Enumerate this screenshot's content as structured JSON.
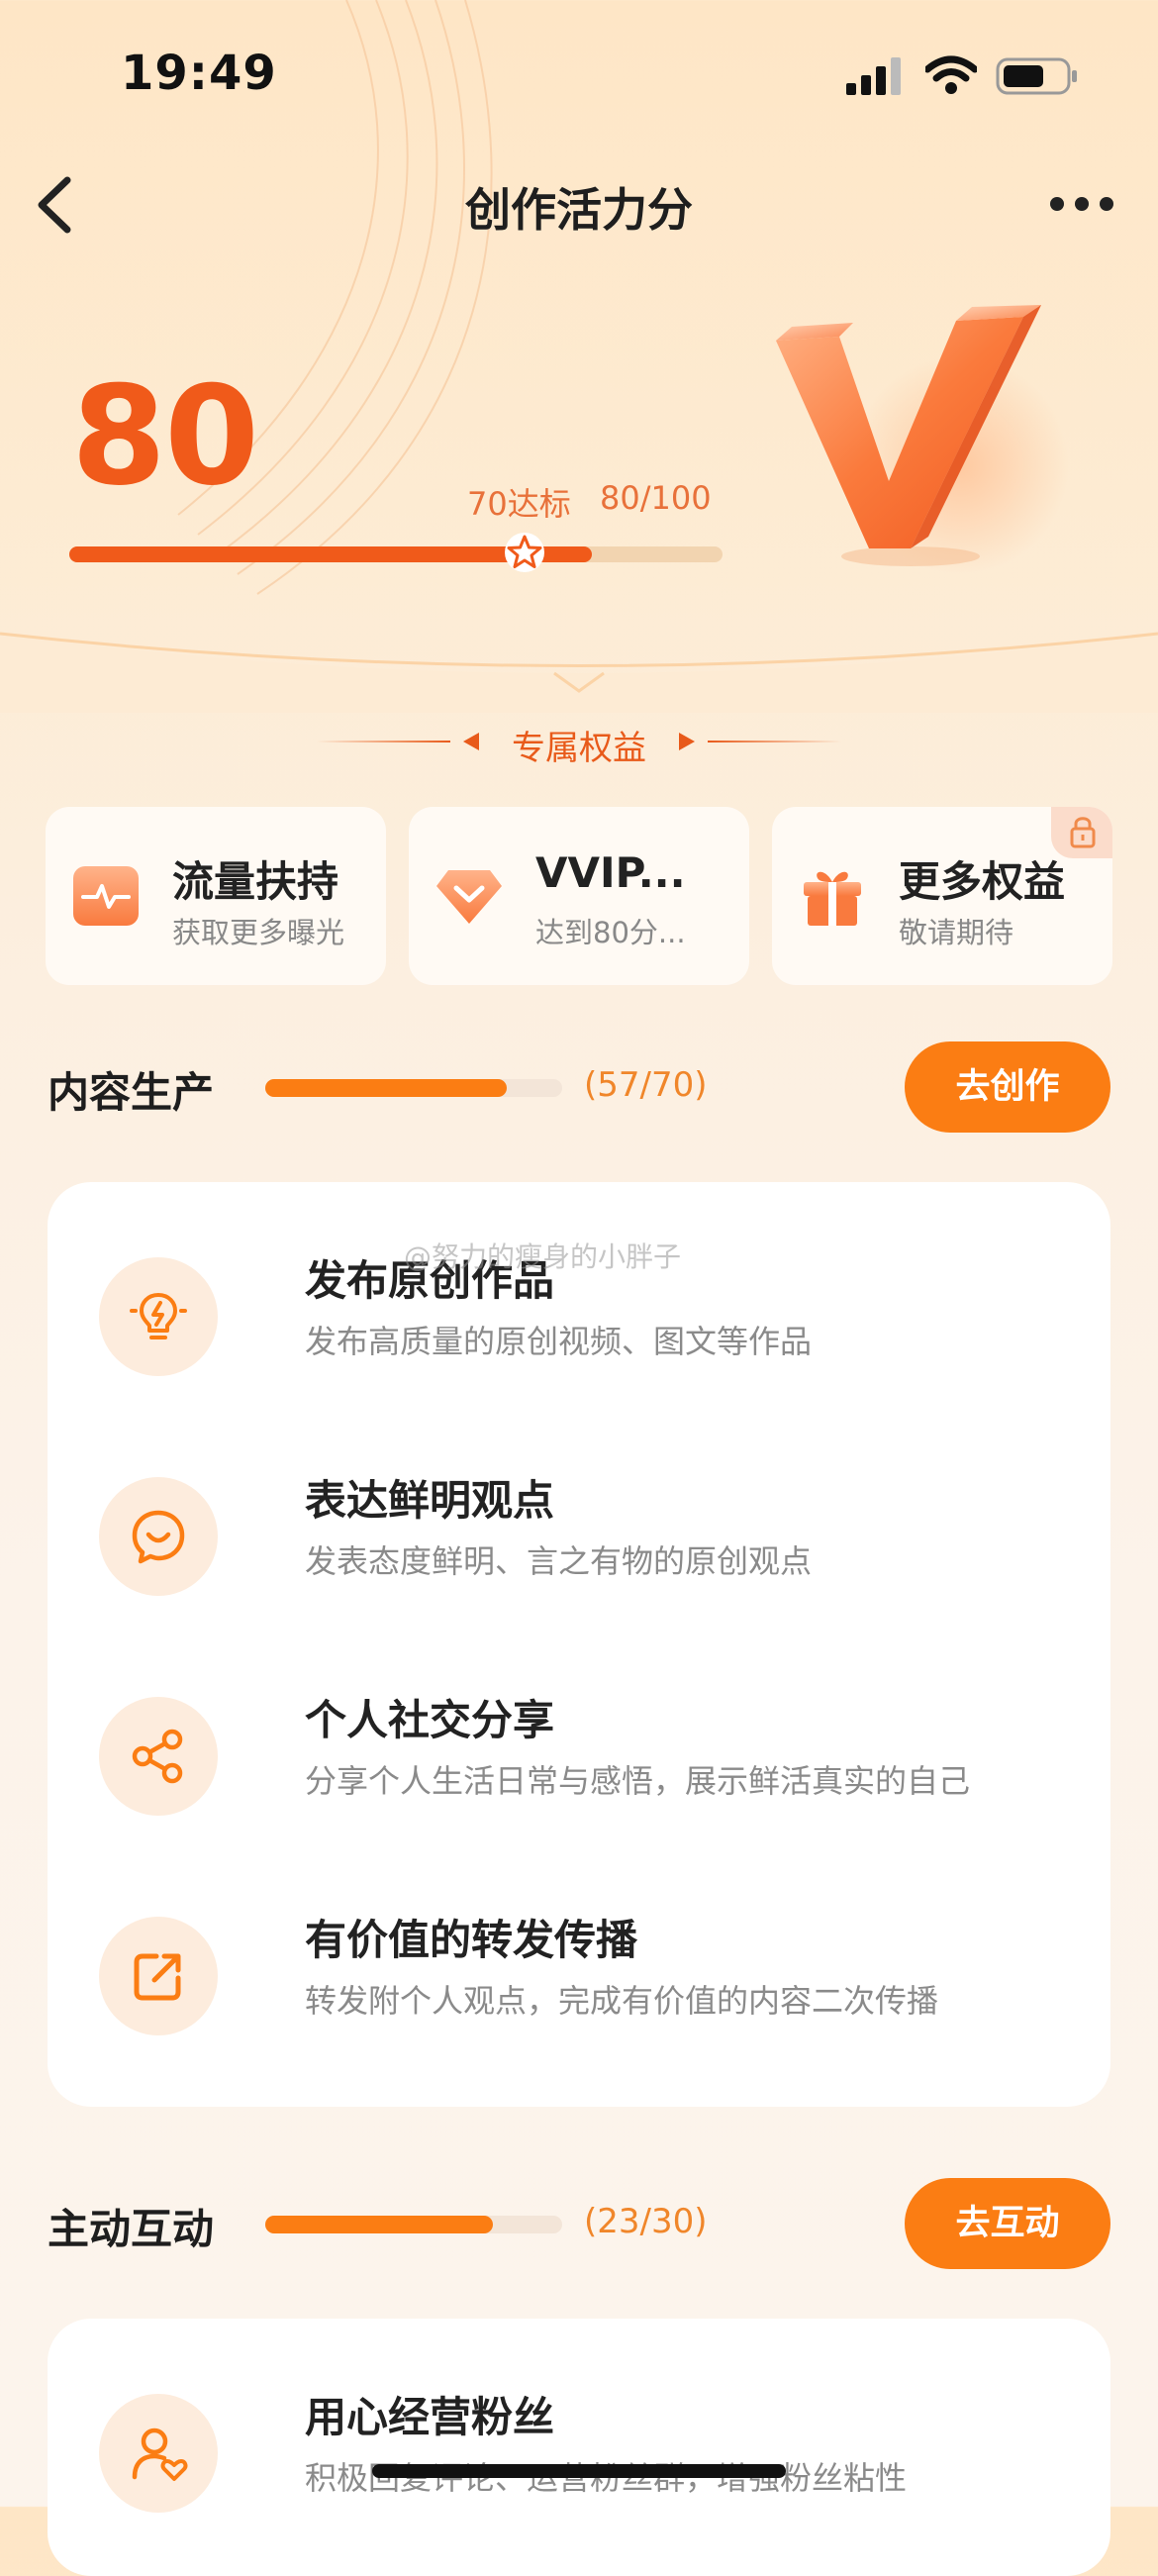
{
  "status_bar": {
    "time": "19:49"
  },
  "nav": {
    "title": "创作活力分"
  },
  "score": {
    "value": "80",
    "target_label": "70达标",
    "progress_text": "80/100",
    "progress": 0.8
  },
  "benefits": {
    "title": "专属权益",
    "cards": [
      {
        "title": "流量扶持",
        "subtitle": "获取更多曝光",
        "icon": "pulse-icon"
      },
      {
        "title": "VVIP...",
        "subtitle": "达到80分...",
        "icon": "diamond-icon"
      },
      {
        "title": "更多权益",
        "subtitle": "敬请期待",
        "icon": "gift-icon"
      }
    ]
  },
  "sections": [
    {
      "title": "内容生产",
      "count": "(57/70)",
      "progress": 0.814,
      "button": "去创作",
      "items": [
        {
          "title": "发布原创作品",
          "desc": "发布高质量的原创视频、图文等作品",
          "icon": "lightbulb-icon"
        },
        {
          "title": "表达鲜明观点",
          "desc": "发表态度鲜明、言之有物的原创观点",
          "icon": "smile-chat-icon"
        },
        {
          "title": "个人社交分享",
          "desc": "分享个人生活日常与感悟，展示鲜活真实的自己",
          "icon": "share-icon"
        },
        {
          "title": "有价值的转发传播",
          "desc": "转发附个人观点，完成有价值的内容二次传播",
          "icon": "forward-icon"
        }
      ]
    },
    {
      "title": "主动互动",
      "count": "(23/30)",
      "progress": 0.767,
      "button": "去互动",
      "items": [
        {
          "title": "用心经营粉丝",
          "desc": "积极回复评论、运营粉丝群，增强粉丝粘性",
          "icon": "user-heart-icon"
        }
      ]
    }
  ],
  "watermark": "@努力的瘦身的小胖子",
  "colors": {
    "accent": "#fb7d13",
    "score": "#f05a1a"
  }
}
